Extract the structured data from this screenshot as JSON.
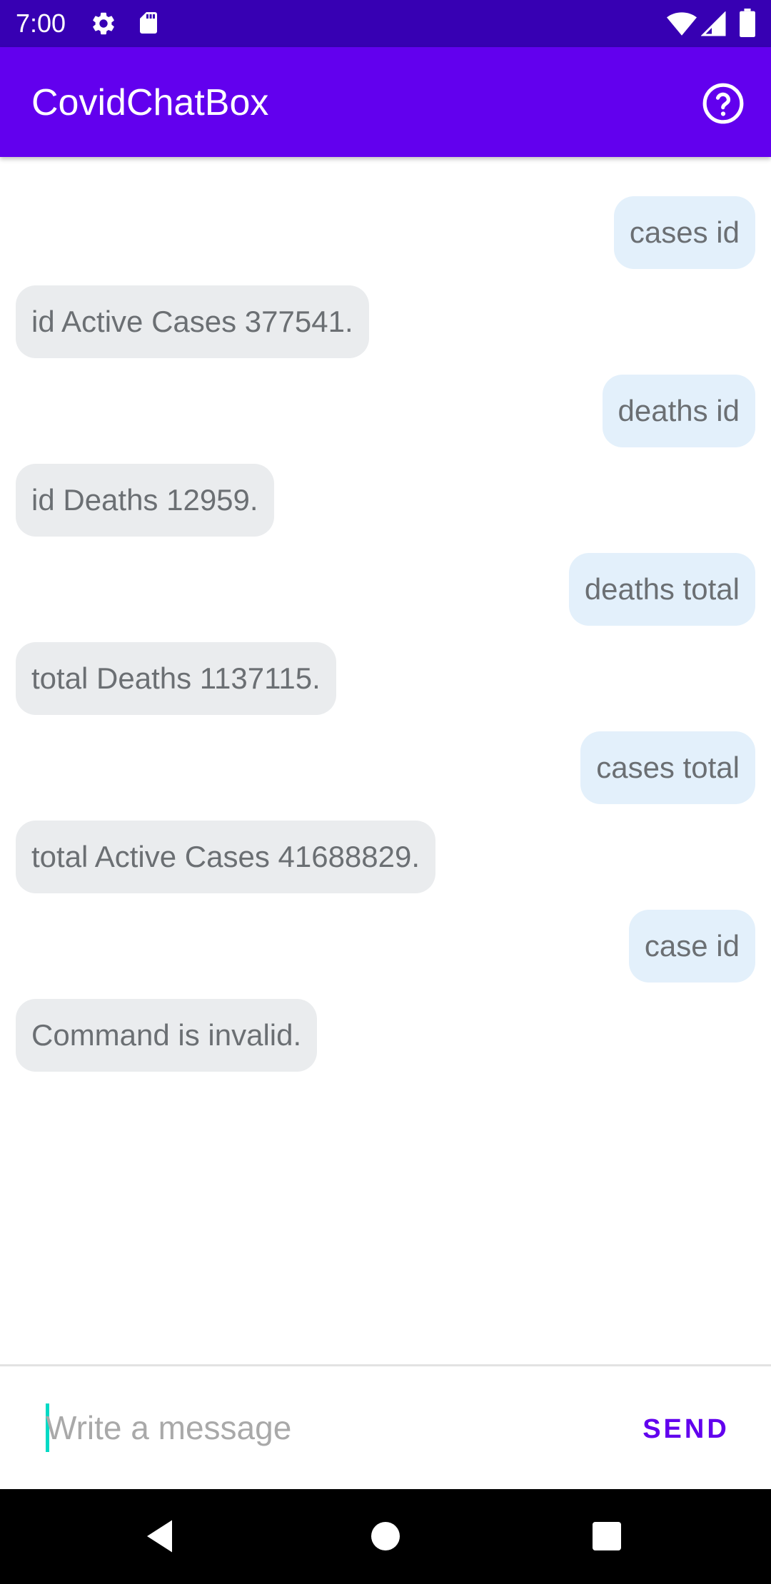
{
  "status_bar": {
    "time": "7:00",
    "icons": [
      "settings-icon",
      "sd-card-icon",
      "wifi-icon",
      "signal-icon",
      "battery-icon"
    ]
  },
  "app_bar": {
    "title": "CovidChatBox",
    "help_icon": "help-circle-icon"
  },
  "messages": [
    {
      "sender": "user",
      "text": "cases id"
    },
    {
      "sender": "bot",
      "text": "id Active Cases 377541."
    },
    {
      "sender": "user",
      "text": "deaths id"
    },
    {
      "sender": "bot",
      "text": "id Deaths 12959."
    },
    {
      "sender": "user",
      "text": "deaths total"
    },
    {
      "sender": "bot",
      "text": "total Deaths 1137115."
    },
    {
      "sender": "user",
      "text": "cases total"
    },
    {
      "sender": "bot",
      "text": "total Active Cases 41688829."
    },
    {
      "sender": "user",
      "text": "case id"
    },
    {
      "sender": "bot",
      "text": "Command is invalid."
    }
  ],
  "composer": {
    "placeholder": "Write a message",
    "value": "",
    "send_label": "SEND"
  },
  "nav_bar": {
    "buttons": [
      "back-icon",
      "home-icon",
      "recents-icon"
    ]
  },
  "colors": {
    "status_bar": "#3700b3",
    "app_bar": "#6200ee",
    "user_bubble": "#e3f0fb",
    "bot_bubble": "#eaecee",
    "accent": "#03dac5"
  }
}
